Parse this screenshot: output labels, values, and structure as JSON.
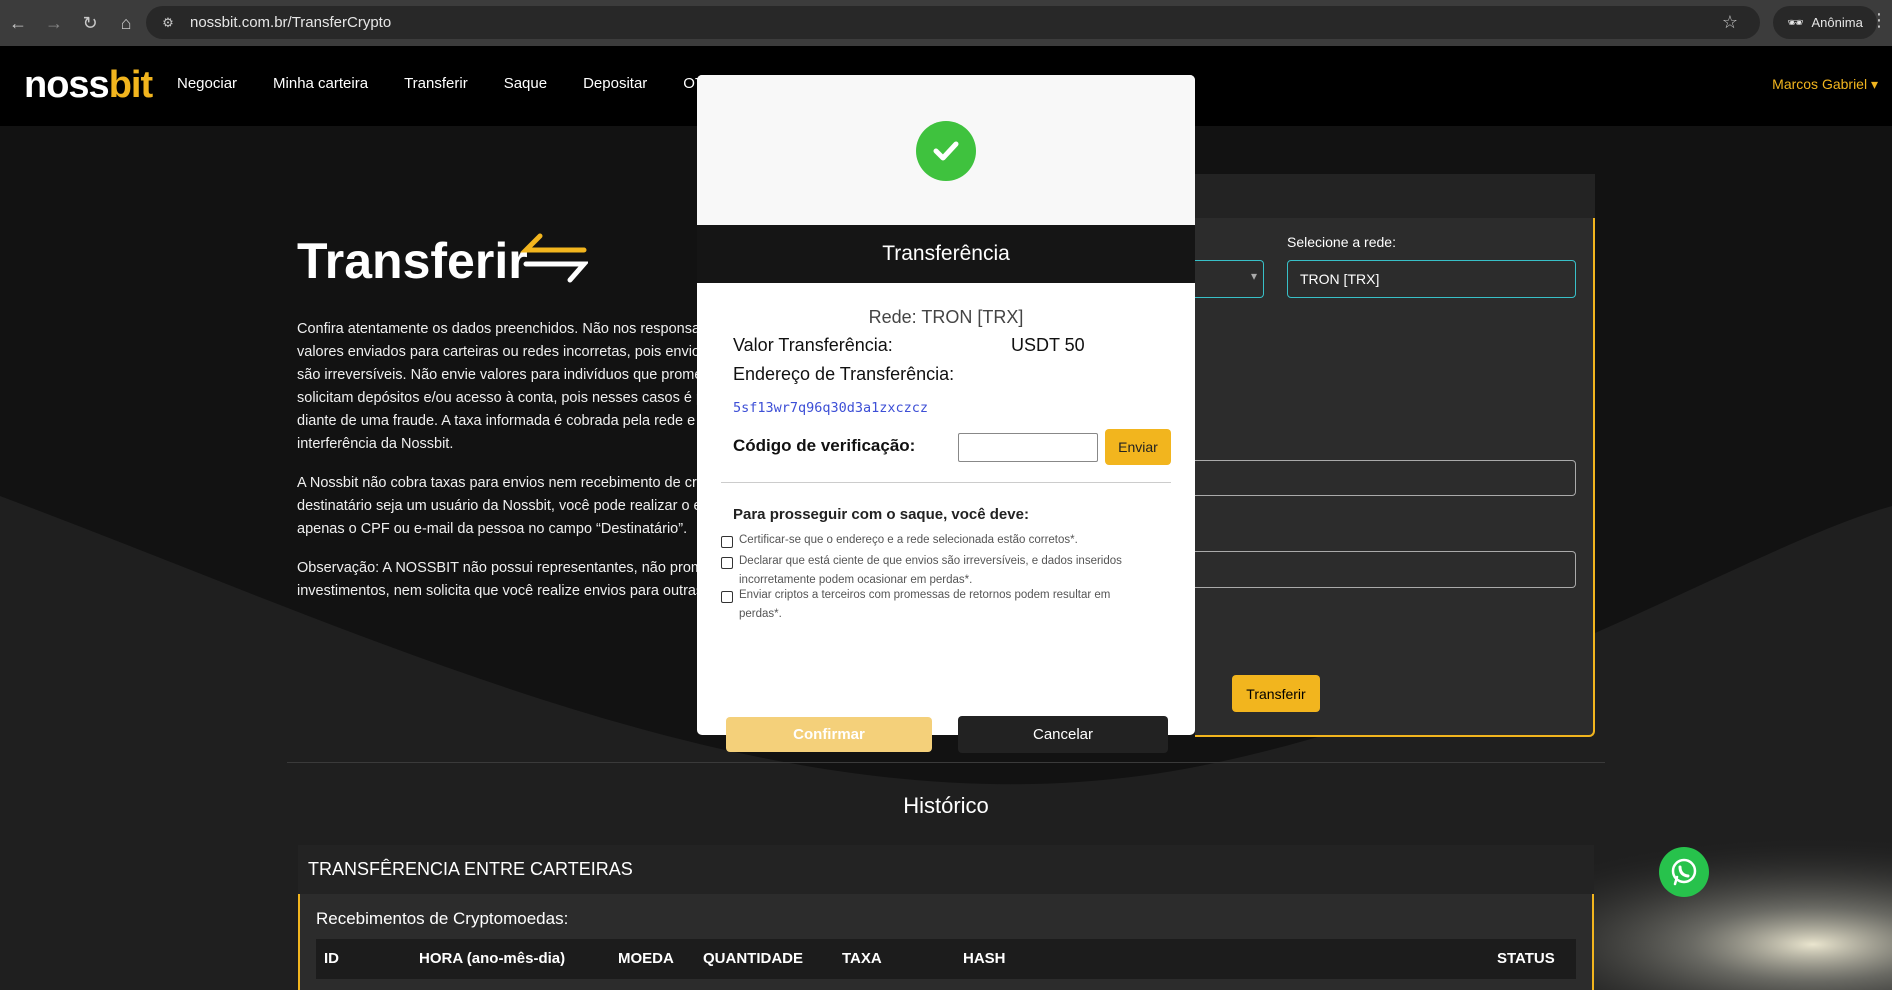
{
  "browser": {
    "url": "nossbit.com.br/TransferCrypto",
    "incognito_label": "Anônima"
  },
  "header": {
    "logo_white": "noss",
    "logo_yellow": "bit",
    "nav": [
      "Negociar",
      "Minha carteira",
      "Transferir",
      "Saque",
      "Depositar",
      "OTC"
    ],
    "user_name": "Marcos Gabriel"
  },
  "hero": {
    "title": "Transferir",
    "paragraphs": [
      [
        "Confira atentamente os dados preenchidos. Não nos responsa",
        "valores enviados para carteiras ou redes incorretas, pois envio",
        "são irreversíveis. Não envie valores para indivíduos que prome",
        "solicitam depósitos e/ou acesso à conta, pois nesses casos é po",
        "diante de uma fraude. A taxa informada é cobrada pela rede e",
        "interferência da Nossbit."
      ],
      [
        "A Nossbit não cobra taxas para envios nem recebimento de cri",
        "destinatário seja um usuário da Nossbit, você pode realizar o e",
        "apenas o CPF ou e-mail da pessoa no campo “Destinatário”."
      ],
      [
        "Observação: A NOSSBIT não possui representantes, não prom",
        "investimentos, nem solicita que você realize envios para outras"
      ]
    ]
  },
  "form": {
    "network_label": "Selecione a rede:",
    "network_value": "TRON [TRX]",
    "submit_label": "Transferir"
  },
  "history": {
    "title": "Histórico",
    "panel_title": "TRANSFÊRENCIA ENTRE CARTEIRAS",
    "subtitle": "Recebimentos de Cryptomoedas:",
    "columns": [
      "ID",
      "HORA (ano-mês-dia)",
      "MOEDA",
      "QUANTIDADE",
      "TAXA",
      "HASH",
      "STATUS"
    ]
  },
  "modal": {
    "title": "Transferência",
    "network_line": "Rede: TRON [TRX]",
    "amount_label": "Valor Transferência:",
    "amount_value": "USDT 50",
    "address_label": "Endereço de Transferência:",
    "address_value": "5sf13wr7q96q30d3a1zxczcz",
    "code_label": "Código de verificação:",
    "code_value": "",
    "send_label": "Enviar",
    "requirements_title": "Para prosseguir com o saque, você deve:",
    "checks": [
      [
        "Certificar-se que o endereço e a rede selecionada estão corretos*."
      ],
      [
        "Declarar que está ciente de que envios são irreversíveis, e dados inseridos",
        "incorretamente podem ocasionar em perdas*."
      ],
      [
        "Enviar criptos a terceiros com promessas de retornos podem resultar em",
        "perdas*."
      ]
    ],
    "confirm_label": "Confirmar",
    "cancel_label": "Cancelar"
  },
  "colors": {
    "accent": "#f2b51e",
    "success": "#3fc23e",
    "link": "#3d4fd6",
    "whatsapp": "#27c24c"
  }
}
